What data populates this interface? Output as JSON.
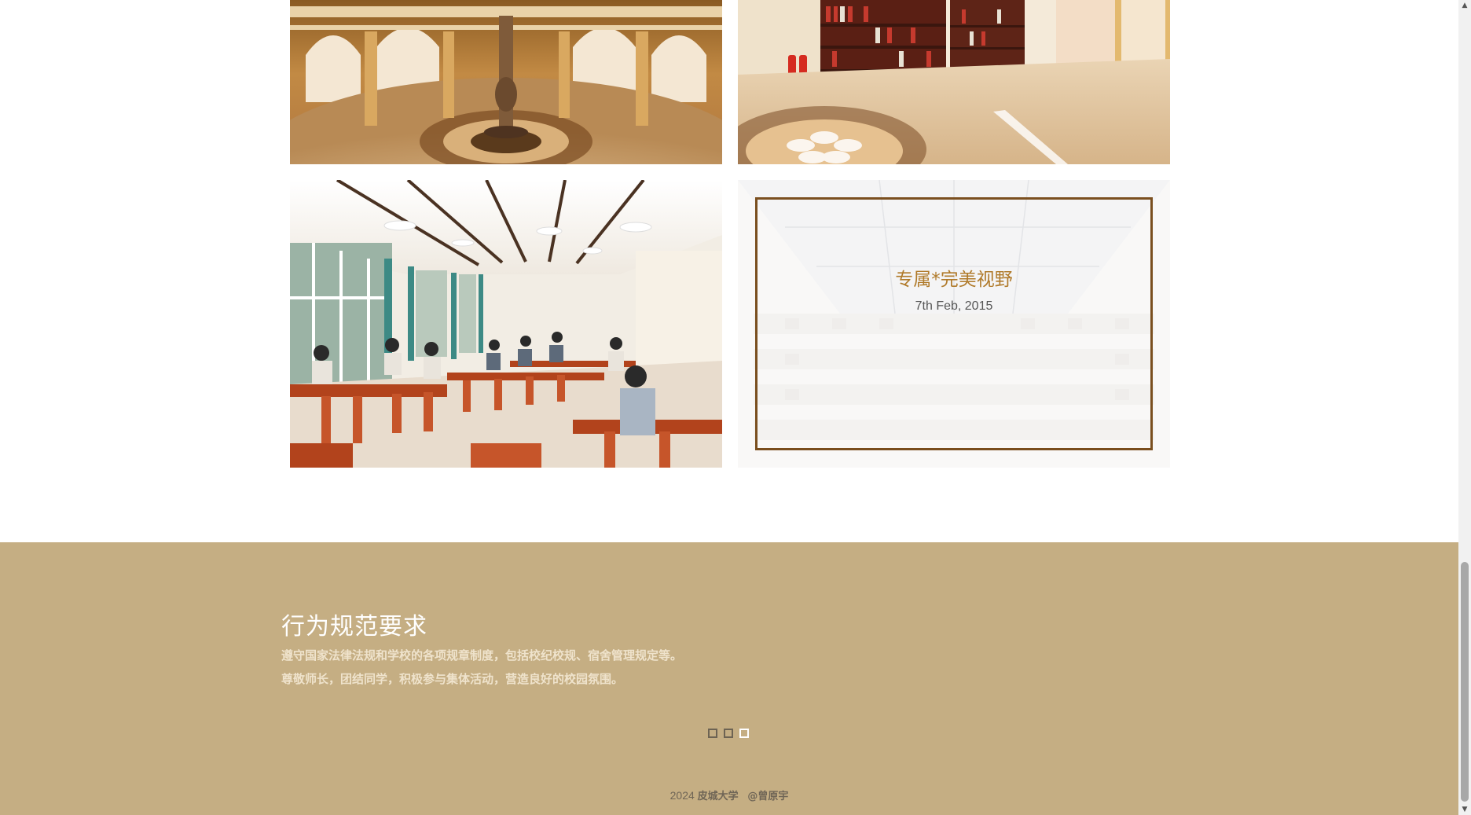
{
  "gallery": {
    "tiles": [
      {
        "name": "rotunda-hall-photo",
        "description_icon": "photo-icon"
      },
      {
        "name": "library-corridor-photo",
        "description_icon": "photo-icon"
      },
      {
        "name": "reading-room-photo",
        "description_icon": "photo-icon"
      },
      {
        "name": "atrium-skylight-photo",
        "description_icon": "photo-icon"
      }
    ],
    "feature": {
      "title": "专属*完美视野",
      "date": "7th Feb, 2015"
    }
  },
  "rules": {
    "title": "行为规范要求",
    "lines": [
      "遵守国家法律法规和学校的各项规章制度，包括校纪校规、宿舍管理规定等。",
      "尊敬师长，团结同学，积极参与集体活动，营造良好的校园氛围。"
    ]
  },
  "pagination": {
    "count": 3,
    "active": 3
  },
  "footer": {
    "year": "2024",
    "school": "皮城大学",
    "author": "@曾原宇"
  },
  "colors": {
    "footer_bg": "#c5ae83",
    "accent_gold": "#b07a2a",
    "frame_brown": "#7a4f1f"
  },
  "scrollbar": {
    "up_icon": "scroll-up-arrow-icon",
    "down_icon": "scroll-down-arrow-icon"
  }
}
